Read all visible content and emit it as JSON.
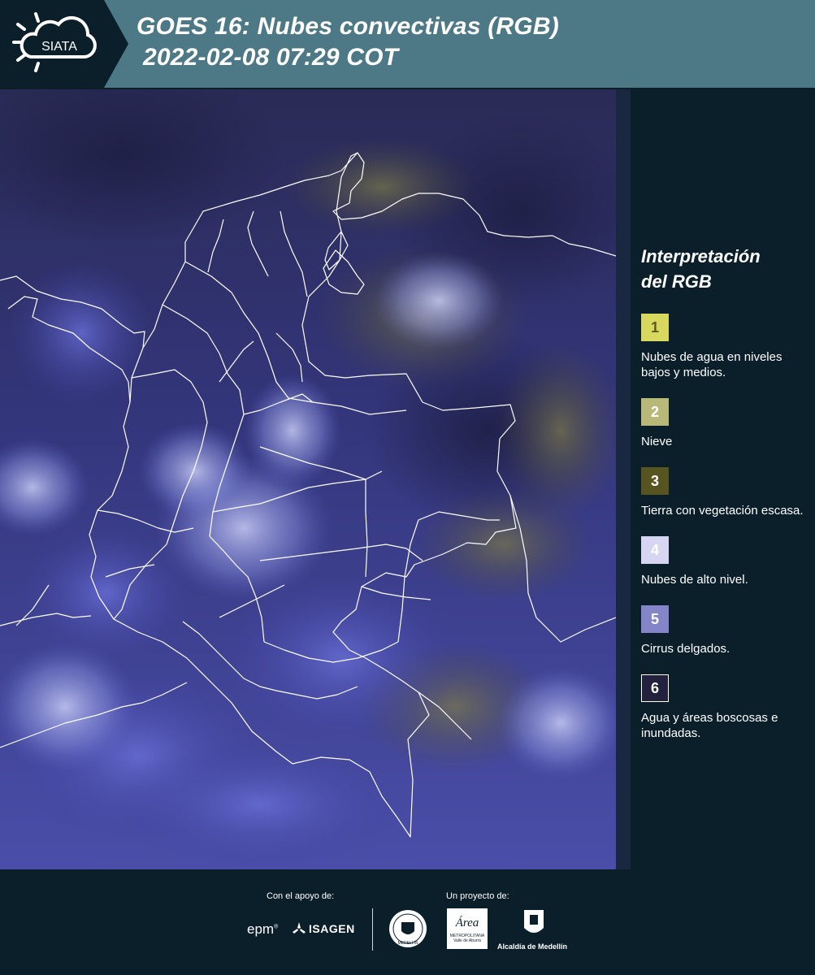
{
  "header": {
    "logo_text": "SIATA",
    "title_line1": "GOES 16: Nubes convectivas (RGB)",
    "title_line2": "2022-02-08 07:29 COT",
    "band_color": "#4d7886",
    "logo_bg_color": "#0b1f2b"
  },
  "map": {
    "description_icon": "satellite-rgb-composite-map",
    "border_color": "#ffffff"
  },
  "legend": {
    "title": "Interpretación del RGB",
    "items": [
      {
        "number": "1",
        "label": "Nubes de agua en niveles bajos y medios.",
        "color": "#d9d85e",
        "number_color": "#5a5a20"
      },
      {
        "number": "2",
        "label": "Nieve",
        "color": "#b8b878",
        "number_color": "#ffffff"
      },
      {
        "number": "3",
        "label": "Tierra con vegetación escasa.",
        "color": "#57541f",
        "number_color": "#ffffff"
      },
      {
        "number": "4",
        "label": "Nubes de alto nivel.",
        "color": "#d6d6f2",
        "number_color": "#ffffff"
      },
      {
        "number": "5",
        "label": "Cirrus delgados.",
        "color": "#8484c8",
        "number_color": "#ffffff"
      },
      {
        "number": "6",
        "label": "Agua y áreas boscosas e inundadas.",
        "color": "#22223e",
        "number_color": "#ffffff"
      }
    ]
  },
  "footer": {
    "support_caption": "Con el apoyo de:",
    "project_caption": "Un proyecto de:",
    "sponsor_epm": "epm",
    "sponsor_isagen": "ISAGEN",
    "org_area_title": "Área",
    "org_area_caption": "METROPOLITANA Valle de Aburrá",
    "org_alcaldia": "Alcaldía de Medellín",
    "org_medellin_seal": "MEDELLÍN"
  }
}
